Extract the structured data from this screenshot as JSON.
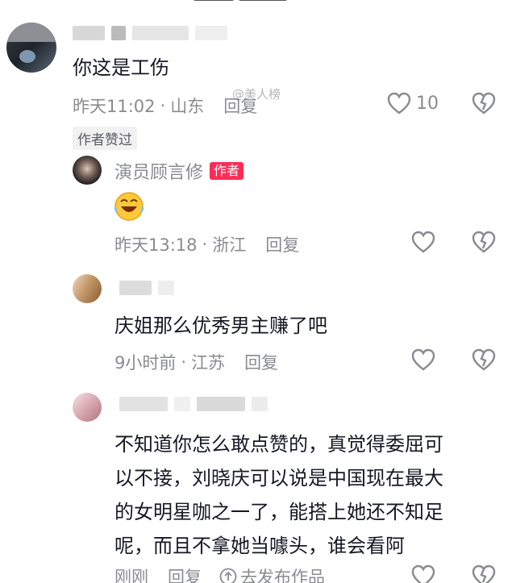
{
  "comments": [
    {
      "text": "你这是工伤",
      "time": "昨天11:02",
      "location": "山东",
      "reply_label": "回复",
      "like_count": "10",
      "author_liked_badge": "作者赞过",
      "watermark": "@美人榜"
    },
    {
      "author_name": "演员顾言修",
      "author_tag": "作者",
      "emoji": "laughing-crying-emoji",
      "time": "昨天13:18",
      "location": "浙江",
      "reply_label": "回复"
    },
    {
      "text": "庆姐那么优秀男主赚了吧",
      "time": "9小时前",
      "location": "江苏",
      "reply_label": "回复"
    },
    {
      "text_lines": [
        "不知道你怎么敢点赞的，真觉得委屈可",
        "以不接，刘晓庆可以说是中国现在最大",
        "的女明星咖之一了，能搭上她还不知足",
        "呢，而且不拿她当噱头，谁会看阿"
      ],
      "time": "刚刚",
      "reply_label": "回复",
      "publish_label": "去发布作品"
    }
  ],
  "separator": "·",
  "colors": {
    "meta_gray": "#8a8b91",
    "author_tag_bg": "#fe2c55",
    "text_dark": "#161823"
  }
}
